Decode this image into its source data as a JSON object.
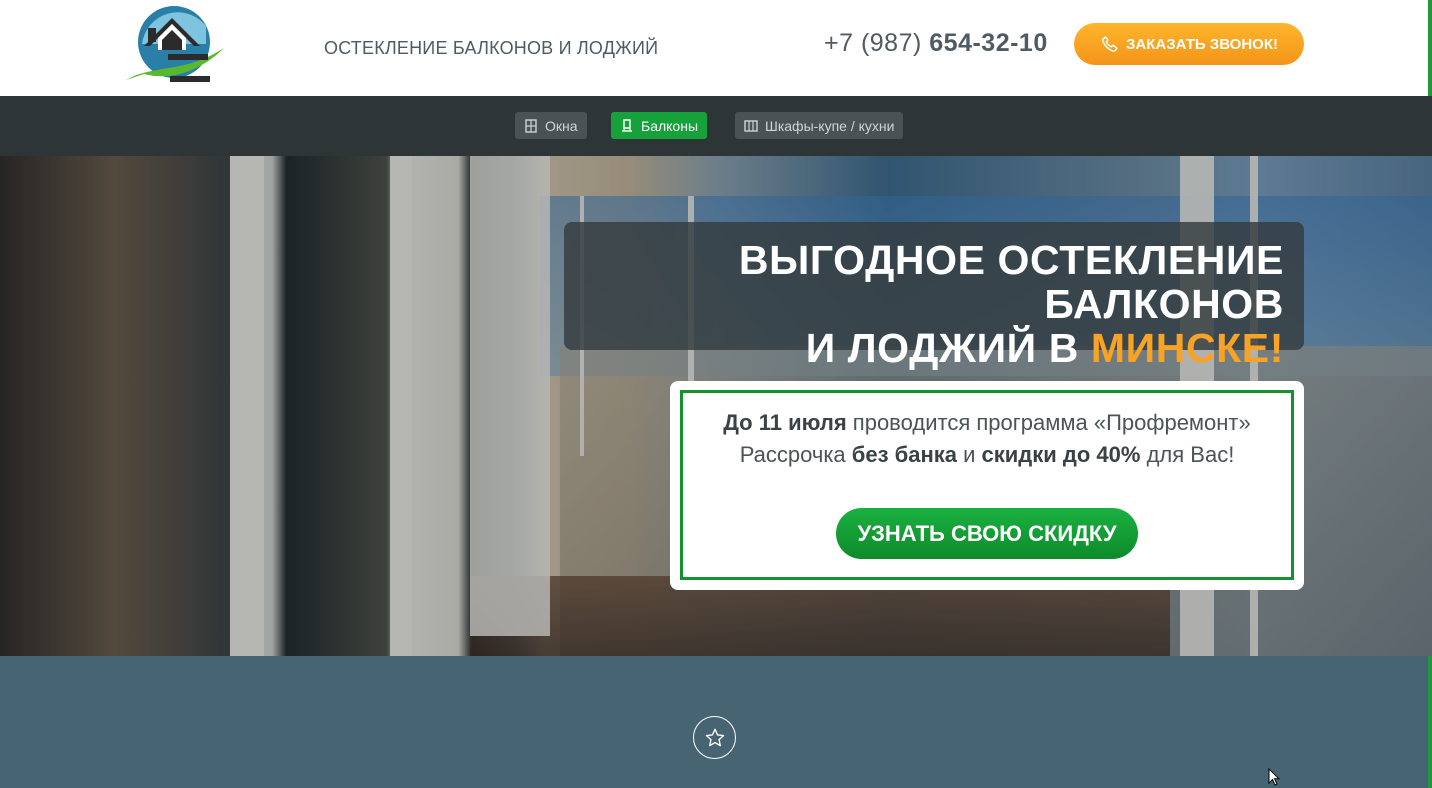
{
  "header": {
    "tagline": "ОСТЕКЛЕНИЕ БАЛКОНОВ И ЛОДЖИЙ",
    "phone_prefix": "+7 (987) ",
    "phone_number": "654-32-10",
    "callback_label": "ЗАКАЗАТЬ ЗВОНОК!"
  },
  "nav": {
    "items": [
      {
        "label": "Окна",
        "icon": "window-icon"
      },
      {
        "label": "Балконы",
        "icon": "balcony-icon",
        "active": true
      },
      {
        "label": "Шкафы-купе / кухни",
        "icon": "wardrobe-icon"
      }
    ]
  },
  "hero": {
    "headline_line1": "ВЫГОДНОЕ ОСТЕКЛЕНИЕ БАЛКОНОВ",
    "headline_line2_prefix": "И ЛОДЖИЙ В ",
    "headline_line2_highlight": "МИНСКЕ!"
  },
  "promo": {
    "l1_bold": "До 11 июля",
    "l1_text": " проводится программа «Профремонт»",
    "l2_a": "Рассрочка ",
    "l2_bold1": "без банка",
    "l2_b": " и ",
    "l2_bold2": "скидки до 40%",
    "l2_c": " для Вас!",
    "button_label": "УЗНАТЬ СВОЮ СКИДКУ"
  },
  "colors": {
    "accent_green": "#16a23b",
    "accent_orange": "#f8a326",
    "nav_bg": "#2e3536",
    "bottom_bg": "#476472"
  }
}
